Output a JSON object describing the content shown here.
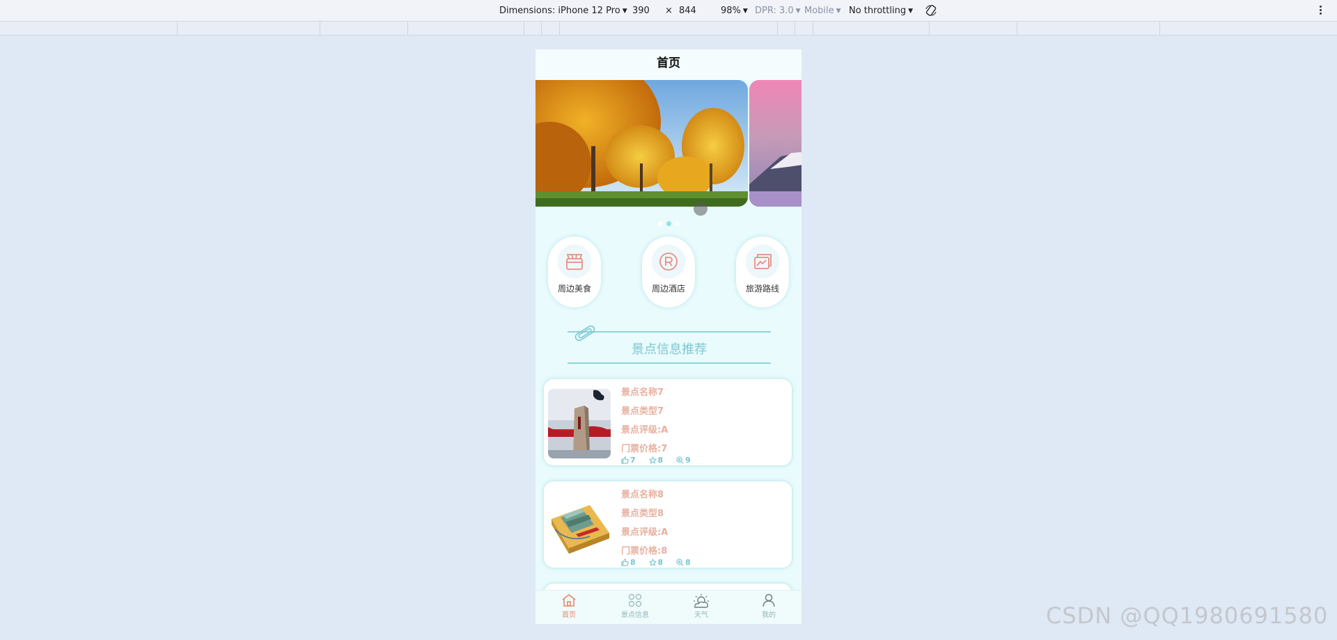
{
  "devtools": {
    "dimensions_label": "Dimensions: iPhone 12 Pro",
    "width": "390",
    "times": "×",
    "height": "844",
    "zoom": "98%",
    "dpr": "DPR: 3.0",
    "mode": "Mobile",
    "throttling": "No throttling"
  },
  "app": {
    "title": "首页",
    "carousel": {
      "count": 3,
      "active_index": 1
    },
    "quick_nav": [
      {
        "label": "周边美食",
        "icon": "food-icon"
      },
      {
        "label": "周边酒店",
        "icon": "hotel-icon"
      },
      {
        "label": "旅游路线",
        "icon": "route-icon"
      }
    ],
    "section_title": "景点信息推荐",
    "spots": [
      {
        "name": "景点名称7",
        "type": "景点类型7",
        "rating": "景点评级:A",
        "price": "门票价格:7",
        "likes": "7",
        "favorites": "8",
        "views": "9"
      },
      {
        "name": "景点名称8",
        "type": "景点类型8",
        "rating": "景点评级:A",
        "price": "门票价格:8",
        "likes": "8",
        "favorites": "8",
        "views": "8"
      }
    ],
    "tabs": [
      {
        "label": "首页",
        "icon": "home-icon",
        "active": true
      },
      {
        "label": "景点信息",
        "icon": "grid-icon",
        "active": false
      },
      {
        "label": "天气",
        "icon": "weather-icon",
        "active": false
      },
      {
        "label": "我的",
        "icon": "user-icon",
        "active": false
      }
    ]
  },
  "watermark": "CSDN @QQ1980691580",
  "colors": {
    "accent_teal": "#7cc7d1",
    "info_text": "#e8b0a0",
    "active_tab": "#e7876a",
    "page_bg": "#e9fbfc"
  }
}
